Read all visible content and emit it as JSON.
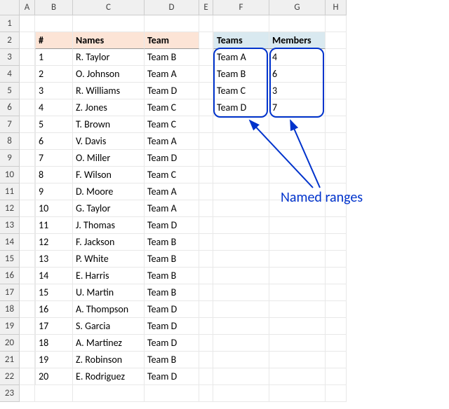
{
  "columns": [
    "A",
    "B",
    "C",
    "D",
    "E",
    "F",
    "G",
    "H"
  ],
  "rowCount": 23,
  "mainTable": {
    "headers": {
      "num": "#",
      "names": "Names",
      "team": "Team"
    },
    "rows": [
      {
        "num": "1",
        "name": "R. Taylor",
        "team": "Team B"
      },
      {
        "num": "2",
        "name": "O. Johnson",
        "team": "Team A"
      },
      {
        "num": "3",
        "name": "R. Williams",
        "team": "Team D"
      },
      {
        "num": "4",
        "name": "Z. Jones",
        "team": "Team C"
      },
      {
        "num": "5",
        "name": "T. Brown",
        "team": "Team C"
      },
      {
        "num": "6",
        "name": "V. Davis",
        "team": "Team A"
      },
      {
        "num": "7",
        "name": "O. Miller",
        "team": "Team D"
      },
      {
        "num": "8",
        "name": "F. Wilson",
        "team": "Team C"
      },
      {
        "num": "9",
        "name": "D. Moore",
        "team": "Team A"
      },
      {
        "num": "10",
        "name": "G. Taylor",
        "team": "Team A"
      },
      {
        "num": "11",
        "name": "J. Thomas",
        "team": "Team D"
      },
      {
        "num": "12",
        "name": "F. Jackson",
        "team": "Team B"
      },
      {
        "num": "13",
        "name": "P. White",
        "team": "Team B"
      },
      {
        "num": "14",
        "name": "E. Harris",
        "team": "Team B"
      },
      {
        "num": "15",
        "name": "U. Martin",
        "team": "Team B"
      },
      {
        "num": "16",
        "name": "A. Thompson",
        "team": "Team D"
      },
      {
        "num": "17",
        "name": "S. Garcia",
        "team": "Team D"
      },
      {
        "num": "18",
        "name": "A. Martinez",
        "team": "Team D"
      },
      {
        "num": "19",
        "name": "Z. Robinson",
        "team": "Team B"
      },
      {
        "num": "20",
        "name": "E. Rodriguez",
        "team": "Team D"
      }
    ]
  },
  "sideTable": {
    "headers": {
      "teams": "Teams",
      "members": "Members"
    },
    "rows": [
      {
        "team": "Team A",
        "members": "4"
      },
      {
        "team": "Team B",
        "members": "6"
      },
      {
        "team": "Team C",
        "members": "3"
      },
      {
        "team": "Team D",
        "members": "7"
      }
    ]
  },
  "annotation": {
    "label": "Named ranges"
  }
}
